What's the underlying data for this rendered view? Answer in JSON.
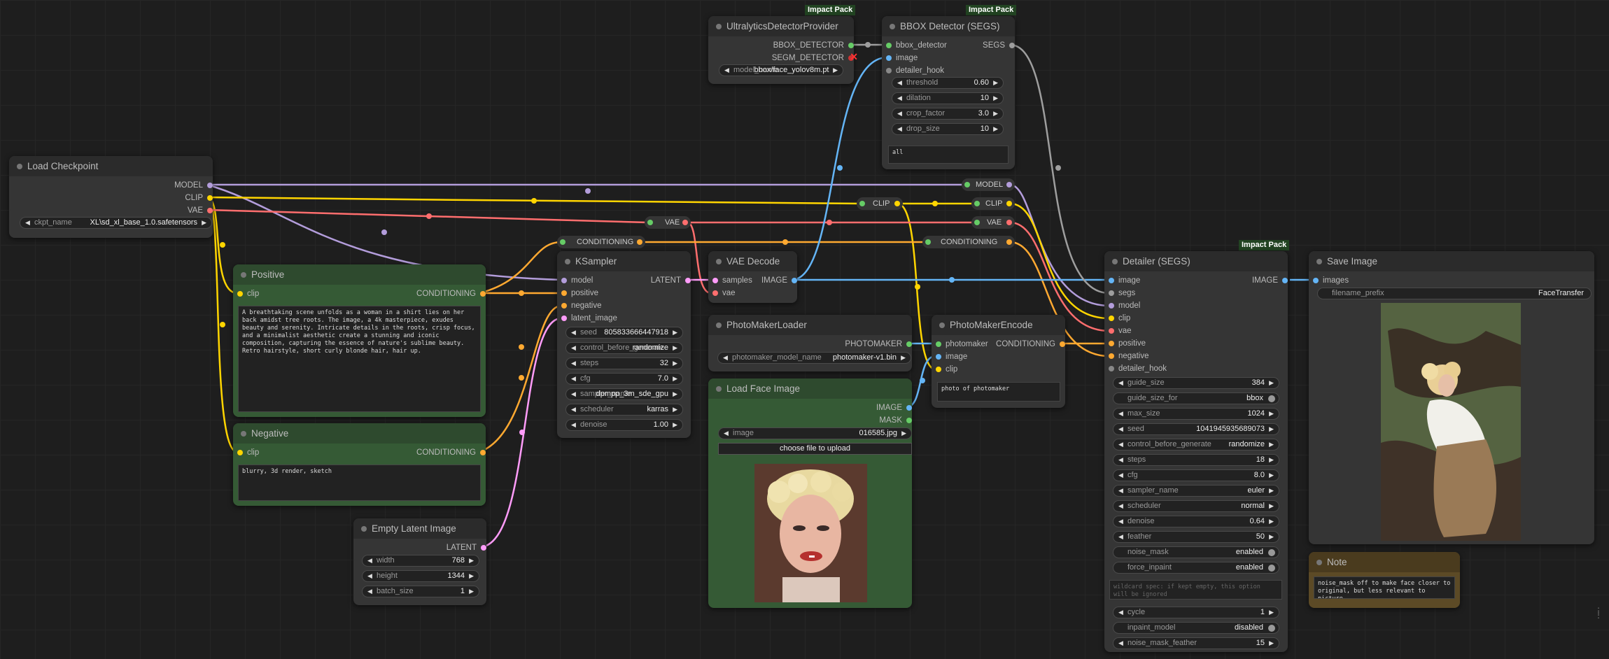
{
  "colors": {
    "model": "#b39ddb",
    "clip": "#ffd500",
    "vae": "#ff6e6e",
    "conditioning": "#ffa931",
    "latent": "#ff9cf9",
    "image": "#64b5f6",
    "detector": "#9e9e9e",
    "group": "#355a35",
    "badge": "#224422"
  },
  "badge": "Impact Pack",
  "load_checkpoint": {
    "title": "Load Checkpoint",
    "out_model": "MODEL",
    "out_clip": "CLIP",
    "out_vae": "VAE",
    "ckpt_label": "ckpt_name",
    "ckpt_value": "XL\\sd_xl_base_1.0.safetensors"
  },
  "positive": {
    "title": "Positive",
    "in_clip": "clip",
    "out": "CONDITIONING",
    "text": "A breathtaking scene unfolds as a woman in a shirt lies on her back amidst tree roots. The image, a 4k masterpiece, exudes beauty and serenity. Intricate details in the roots, crisp focus, and a minimalist aesthetic create a stunning and iconic composition, capturing the essence of nature's sublime beauty. Retro hairstyle, short curly blonde hair, hair up."
  },
  "negative": {
    "title": "Negative",
    "in_clip": "clip",
    "out": "CONDITIONING",
    "text": "blurry, 3d render, sketch"
  },
  "empty_latent": {
    "title": "Empty Latent Image",
    "out": "LATENT",
    "width_label": "width",
    "width": "768",
    "height_label": "height",
    "height": "1344",
    "batch_label": "batch_size",
    "batch": "1"
  },
  "ksampler": {
    "title": "KSampler",
    "in_model": "model",
    "in_positive": "positive",
    "in_negative": "negative",
    "in_latent": "latent_image",
    "out": "LATENT",
    "widgets": [
      {
        "label": "seed",
        "value": "805833666447918"
      },
      {
        "label": "control_before_generate",
        "value": "randomize"
      },
      {
        "label": "steps",
        "value": "32"
      },
      {
        "label": "cfg",
        "value": "7.0"
      },
      {
        "label": "sampler_name",
        "value": "dpmpp_3m_sde_gpu"
      },
      {
        "label": "scheduler",
        "value": "karras"
      },
      {
        "label": "denoise",
        "value": "1.00"
      }
    ]
  },
  "reroutes": {
    "conditioning": "CONDITIONING",
    "vae": "VAE",
    "clip": "CLIP"
  },
  "ultralytics": {
    "title": "UltralyticsDetectorProvider",
    "out_bbox": "BBOX_DETECTOR",
    "out_segm": "SEGM_DETECTOR",
    "model_label": "model_name",
    "model_value": "bbox/face_yolov8m.pt"
  },
  "bbox_detector": {
    "title": "BBOX Detector (SEGS)",
    "in_bbox": "bbox_detector",
    "in_image": "image",
    "in_hook": "detailer_hook",
    "out": "SEGS",
    "widgets": [
      {
        "label": "threshold",
        "value": "0.60"
      },
      {
        "label": "dilation",
        "value": "10"
      },
      {
        "label": "crop_factor",
        "value": "3.0"
      },
      {
        "label": "drop_size",
        "value": "10"
      }
    ],
    "text": "all"
  },
  "vae_decode": {
    "title": "VAE Decode",
    "in_samples": "samples",
    "in_vae": "vae",
    "out": "IMAGE"
  },
  "photomaker_loader": {
    "title": "PhotoMakerLoader",
    "out": "PHOTOMAKER",
    "model_label": "photomaker_model_name",
    "model_value": "photomaker-v1.bin"
  },
  "load_face": {
    "title": "Load Face Image",
    "out_image": "IMAGE",
    "out_mask": "MASK",
    "image_label": "image",
    "image_value": "016585.jpg",
    "upload": "choose file to upload"
  },
  "photomaker_encode": {
    "title": "PhotoMakerEncode",
    "in_photomaker": "photomaker",
    "in_image": "image",
    "in_clip": "clip",
    "out": "CONDITIONING",
    "text": "photo of photomaker"
  },
  "detailer": {
    "title": "Detailer (SEGS)",
    "out": "IMAGE",
    "inputs": [
      "image",
      "segs",
      "model",
      "clip",
      "vae",
      "positive",
      "negative",
      "detailer_hook"
    ],
    "widgets": [
      {
        "label": "guide_size",
        "value": "384"
      },
      {
        "label": "guide_size_for",
        "value": "bbox",
        "toggle": true
      },
      {
        "label": "max_size",
        "value": "1024"
      },
      {
        "label": "seed",
        "value": "1041945935689073"
      },
      {
        "label": "control_before_generate",
        "value": "randomize"
      },
      {
        "label": "steps",
        "value": "18"
      },
      {
        "label": "cfg",
        "value": "8.0"
      },
      {
        "label": "sampler_name",
        "value": "euler"
      },
      {
        "label": "scheduler",
        "value": "normal"
      },
      {
        "label": "denoise",
        "value": "0.64"
      },
      {
        "label": "feather",
        "value": "50"
      },
      {
        "label": "noise_mask",
        "value": "enabled",
        "toggle": true
      },
      {
        "label": "force_inpaint",
        "value": "enabled",
        "toggle": true
      }
    ],
    "wildcard": "wildcard spec: if kept empty, this option will be ignored",
    "widgets2": [
      {
        "label": "cycle",
        "value": "1"
      },
      {
        "label": "inpaint_model",
        "value": "disabled",
        "toggle": true
      },
      {
        "label": "noise_mask_feather",
        "value": "15"
      }
    ]
  },
  "save_image": {
    "title": "Save Image",
    "in": "images",
    "prefix_label": "filename_prefix",
    "prefix_value": "FaceTransfer"
  },
  "note": {
    "title": "Note",
    "text": "noise_mask off to make face closer to original, but less relevant to picture"
  }
}
